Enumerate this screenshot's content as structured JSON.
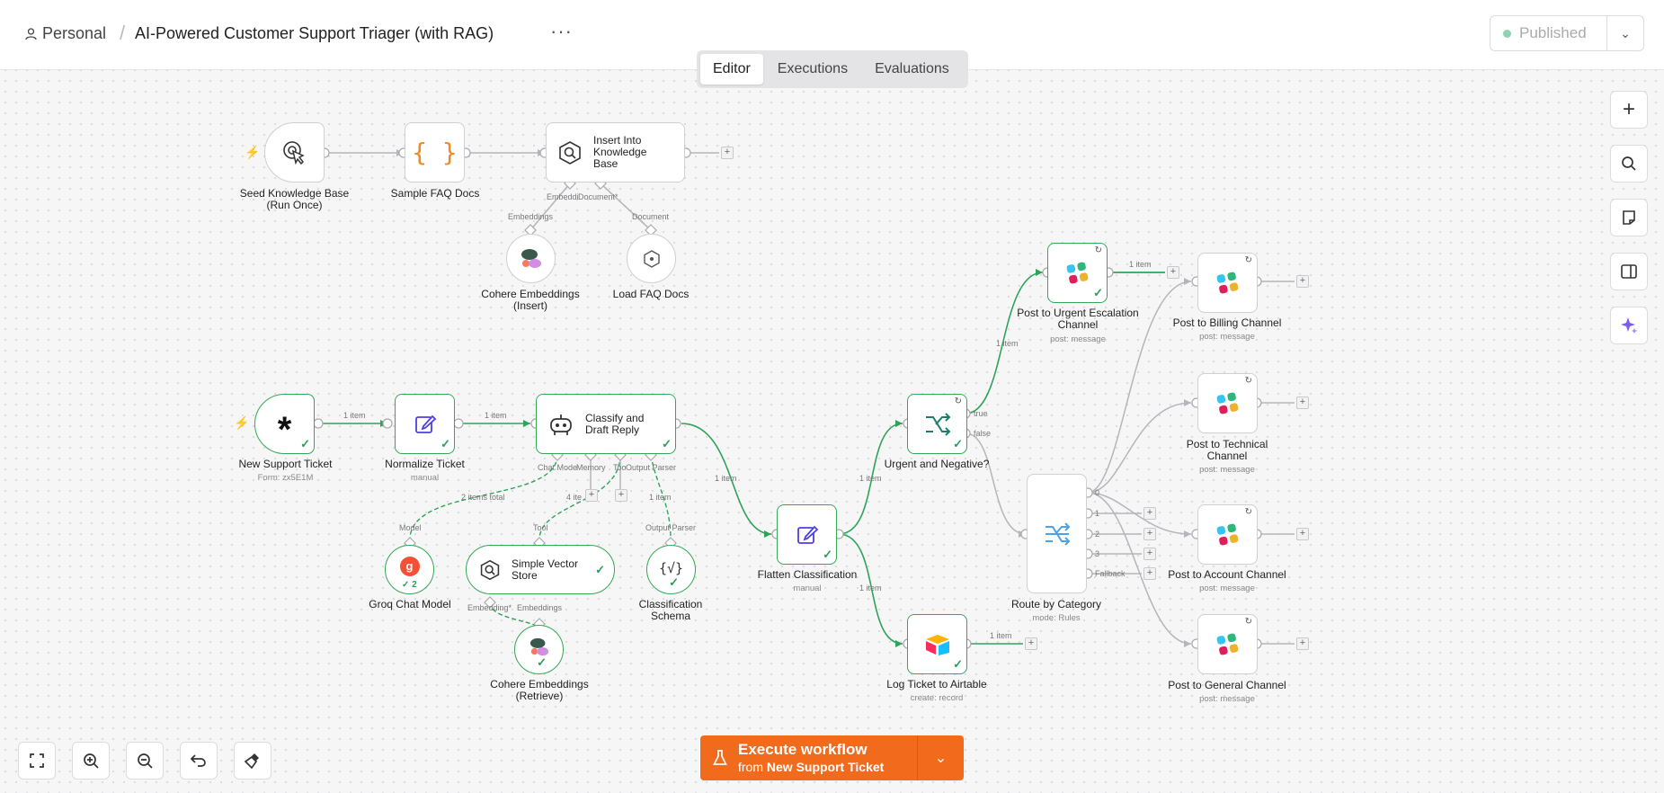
{
  "header": {
    "workspace": "Personal",
    "separator": "/",
    "title": "AI-Powered Customer Support Triager (with RAG)",
    "menu": "···",
    "status": "Published"
  },
  "tabs": [
    "Editor",
    "Executions",
    "Evaluations"
  ],
  "nodes": {
    "seed_kb": {
      "title": "Seed Knowledge Base",
      "title2": "(Run Once)"
    },
    "sample_faq": {
      "title": "Sample FAQ Docs"
    },
    "insert_kb": {
      "title": "Insert Into Knowledge Base"
    },
    "cohere_insert": {
      "title": "Cohere Embeddings",
      "title2": "(Insert)"
    },
    "load_faq": {
      "title": "Load FAQ Docs"
    },
    "new_ticket": {
      "title": "New Support Ticket",
      "sub": "Form: zx5E1M"
    },
    "normalize": {
      "title": "Normalize Ticket",
      "sub": "manual"
    },
    "classify": {
      "title": "Classify and Draft Reply"
    },
    "groq": {
      "title": "Groq Chat Model",
      "badge": "2"
    },
    "vector": {
      "title": "Simple Vector Store"
    },
    "schema": {
      "title": "Classification",
      "title2": "Schema"
    },
    "cohere_retrieve": {
      "title": "Cohere Embeddings",
      "title2": "(Retrieve)"
    },
    "flatten": {
      "title": "Flatten Classification",
      "sub": "manual"
    },
    "urgent": {
      "title": "Urgent and Negative?"
    },
    "route": {
      "title": "Route by Category",
      "sub": "mode: Rules"
    },
    "airtable": {
      "title": "Log Ticket to Airtable",
      "sub": "create: record"
    },
    "post_urgent": {
      "title": "Post to Urgent Escalation",
      "title2": "Channel",
      "sub": "post: message"
    },
    "post_billing": {
      "title": "Post to Billing Channel",
      "sub": "post: message"
    },
    "post_technical": {
      "title": "Post to Technical",
      "title2": "Channel",
      "sub": "post: message"
    },
    "post_account": {
      "title": "Post to Account Channel",
      "sub": "post: message"
    },
    "post_general": {
      "title": "Post to General Channel",
      "sub": "post: message"
    }
  },
  "edge_labels": {
    "one_item": "1 item",
    "two_items_total": "2 items total",
    "four_items": "4 ite",
    "true": "true",
    "false": "false"
  },
  "handle_labels": {
    "embeddings_trunc": "Embeddi",
    "document_req": "Document*",
    "embeddings": "Embeddings",
    "document": "Document",
    "chat_model": "Chat Mode",
    "memory": "Memory",
    "tool_trunc": "Too",
    "output_parser": "Output Parser",
    "model": "Model",
    "tool": "Tool",
    "embedding_req": "Embedding*",
    "route_outputs": [
      "0",
      "1",
      "2",
      "3",
      "Fallback"
    ]
  },
  "execute": {
    "label": "Execute workflow",
    "from_prefix": "from",
    "from_node": "New Support Ticket"
  },
  "colors": {
    "accent": "#f26b1d",
    "success": "#34a853",
    "edge_default": "#b5b5ba"
  }
}
